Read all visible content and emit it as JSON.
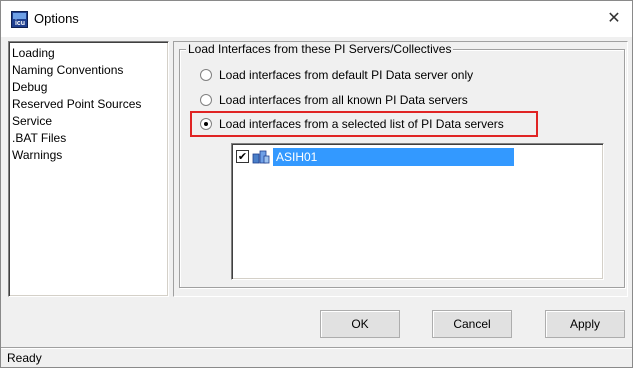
{
  "window": {
    "title": "Options",
    "icon_label": "icu",
    "close_glyph": "✕"
  },
  "sidebar": {
    "items": [
      {
        "label": "Loading"
      },
      {
        "label": "Naming Conventions"
      },
      {
        "label": "Debug"
      },
      {
        "label": "Reserved Point Sources"
      },
      {
        "label": "Service"
      },
      {
        "label": ".BAT Files"
      },
      {
        "label": "Warnings"
      }
    ]
  },
  "group": {
    "label": "Load Interfaces from these PI Servers/Collectives",
    "options": [
      {
        "label": "Load interfaces from default PI Data server only",
        "checked": false
      },
      {
        "label": "Load interfaces from all known PI Data servers",
        "checked": false
      },
      {
        "label": "Load interfaces from a selected list of PI Data servers",
        "checked": true
      }
    ],
    "highlight_color": "#e02424"
  },
  "servers": [
    {
      "name": "ASIH01",
      "checked": true,
      "selected": true,
      "check_glyph": "✔"
    }
  ],
  "buttons": {
    "ok": "OK",
    "cancel": "Cancel",
    "apply": "Apply"
  },
  "status": {
    "text": "Ready"
  },
  "colors": {
    "selection": "#3399ff",
    "highlight": "#e02424"
  }
}
